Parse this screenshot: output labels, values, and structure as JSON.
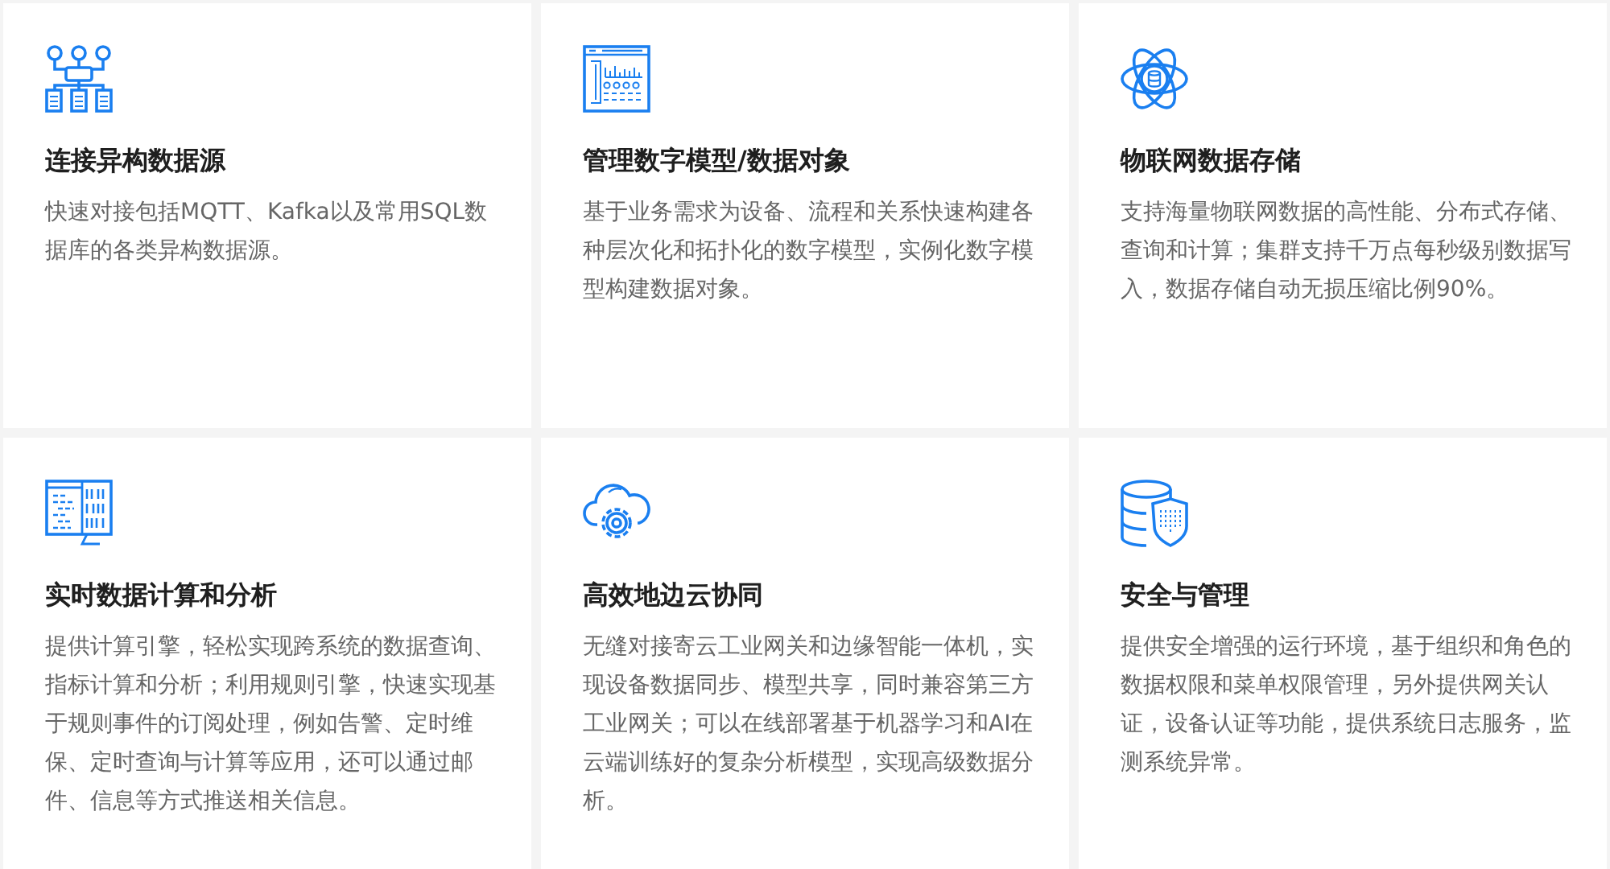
{
  "features": [
    {
      "title": "连接异构数据源",
      "description": "快速对接包括MQTT、Kafka以及常用SQL数据库的各类异构数据源。"
    },
    {
      "title": "管理数字模型/数据对象",
      "description": "基于业务需求为设备、流程和关系快速构建各种层次化和拓扑化的数字模型，实例化数字模型构建数据对象。"
    },
    {
      "title": "物联网数据存储",
      "description": "支持海量物联网数据的高性能、分布式存储、查询和计算；集群支持千万点每秒级别数据写入，数据存储自动无损压缩比例90%。"
    },
    {
      "title": "实时数据计算和分析",
      "description": "提供计算引擎，轻松实现跨系统的数据查询、指标计算和分析；利用规则引擎，快速实现基于规则事件的订阅处理，例如告警、定时维保、定时查询与计算等应用，还可以通过邮件、信息等方式推送相关信息。"
    },
    {
      "title": "高效地边云协同",
      "description": "无缝对接寄云工业网关和边缘智能一体机，实现设备数据同步、模型共享，同时兼容第三方工业网关；可以在线部署基于机器学习和AI在云端训练好的复杂分析模型，实现高级数据分析。"
    },
    {
      "title": "安全与管理",
      "description": "提供安全增强的运行环境，基于组织和角色的数据权限和菜单权限管理，另外提供网关认证，设备认证等功能，提供系统日志服务，监测系统异常。"
    }
  ]
}
